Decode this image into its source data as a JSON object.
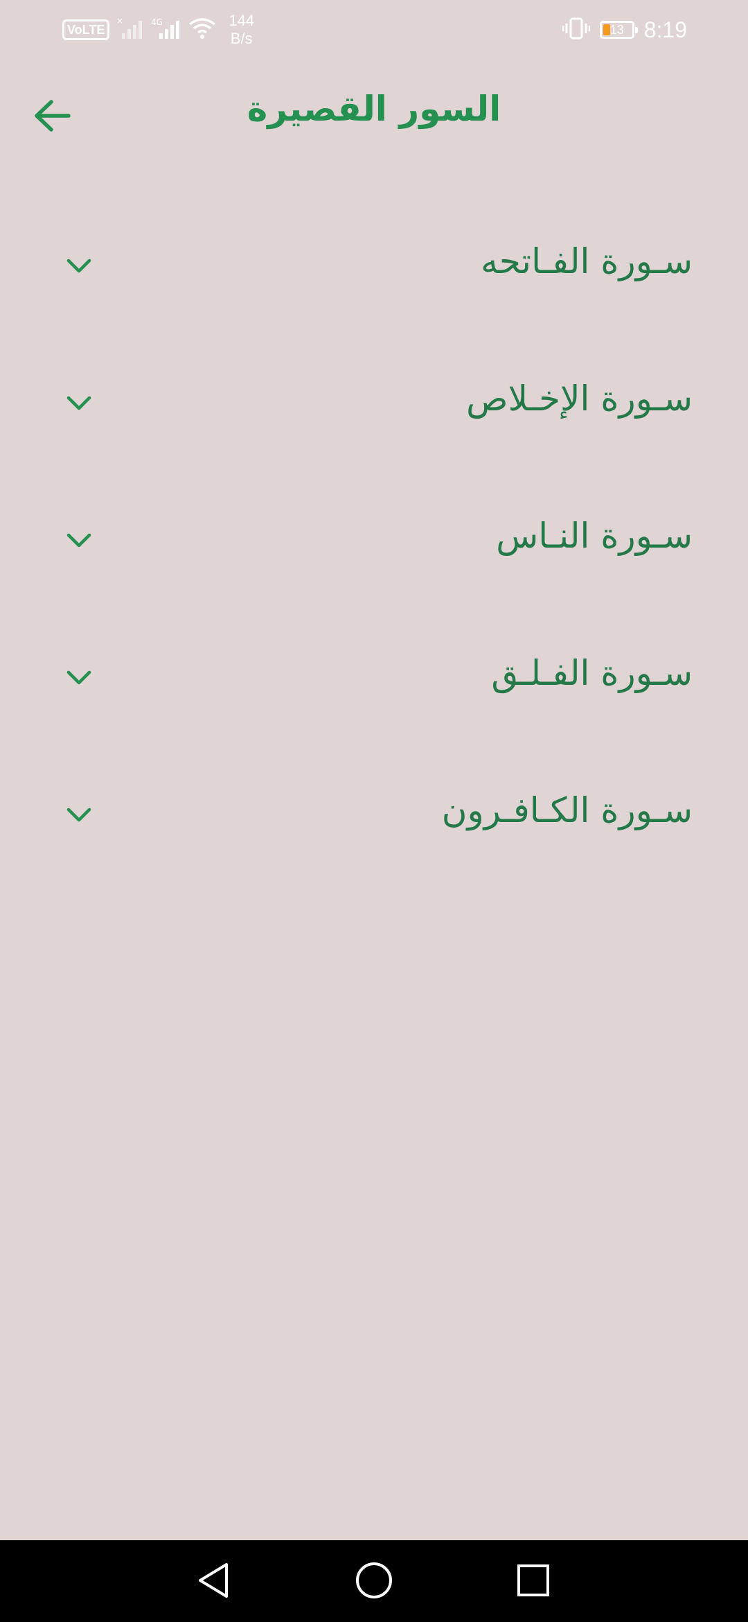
{
  "status_bar": {
    "volte": "VoLTE",
    "network_type": "4G",
    "net_speed_value": "144",
    "net_speed_unit": "B/s",
    "battery_level": "13",
    "time": "8:19"
  },
  "header": {
    "title": "السور القصيرة",
    "back_icon": "arrow-left-icon"
  },
  "surahs": [
    {
      "name": "سـورة الفـاتحه"
    },
    {
      "name": "سـورة الإخـلاص"
    },
    {
      "name": "سـورة النـاس"
    },
    {
      "name": "سـورة الفـلـق"
    },
    {
      "name": "سـورة الكـافـرون"
    }
  ],
  "nav_bar": {
    "back_icon": "triangle-back-icon",
    "home_icon": "circle-home-icon",
    "recents_icon": "square-recents-icon"
  },
  "colors": {
    "background": "#e0d4d4",
    "accent": "#259150",
    "text": "#237a48",
    "battery_low": "#f39a1e"
  }
}
